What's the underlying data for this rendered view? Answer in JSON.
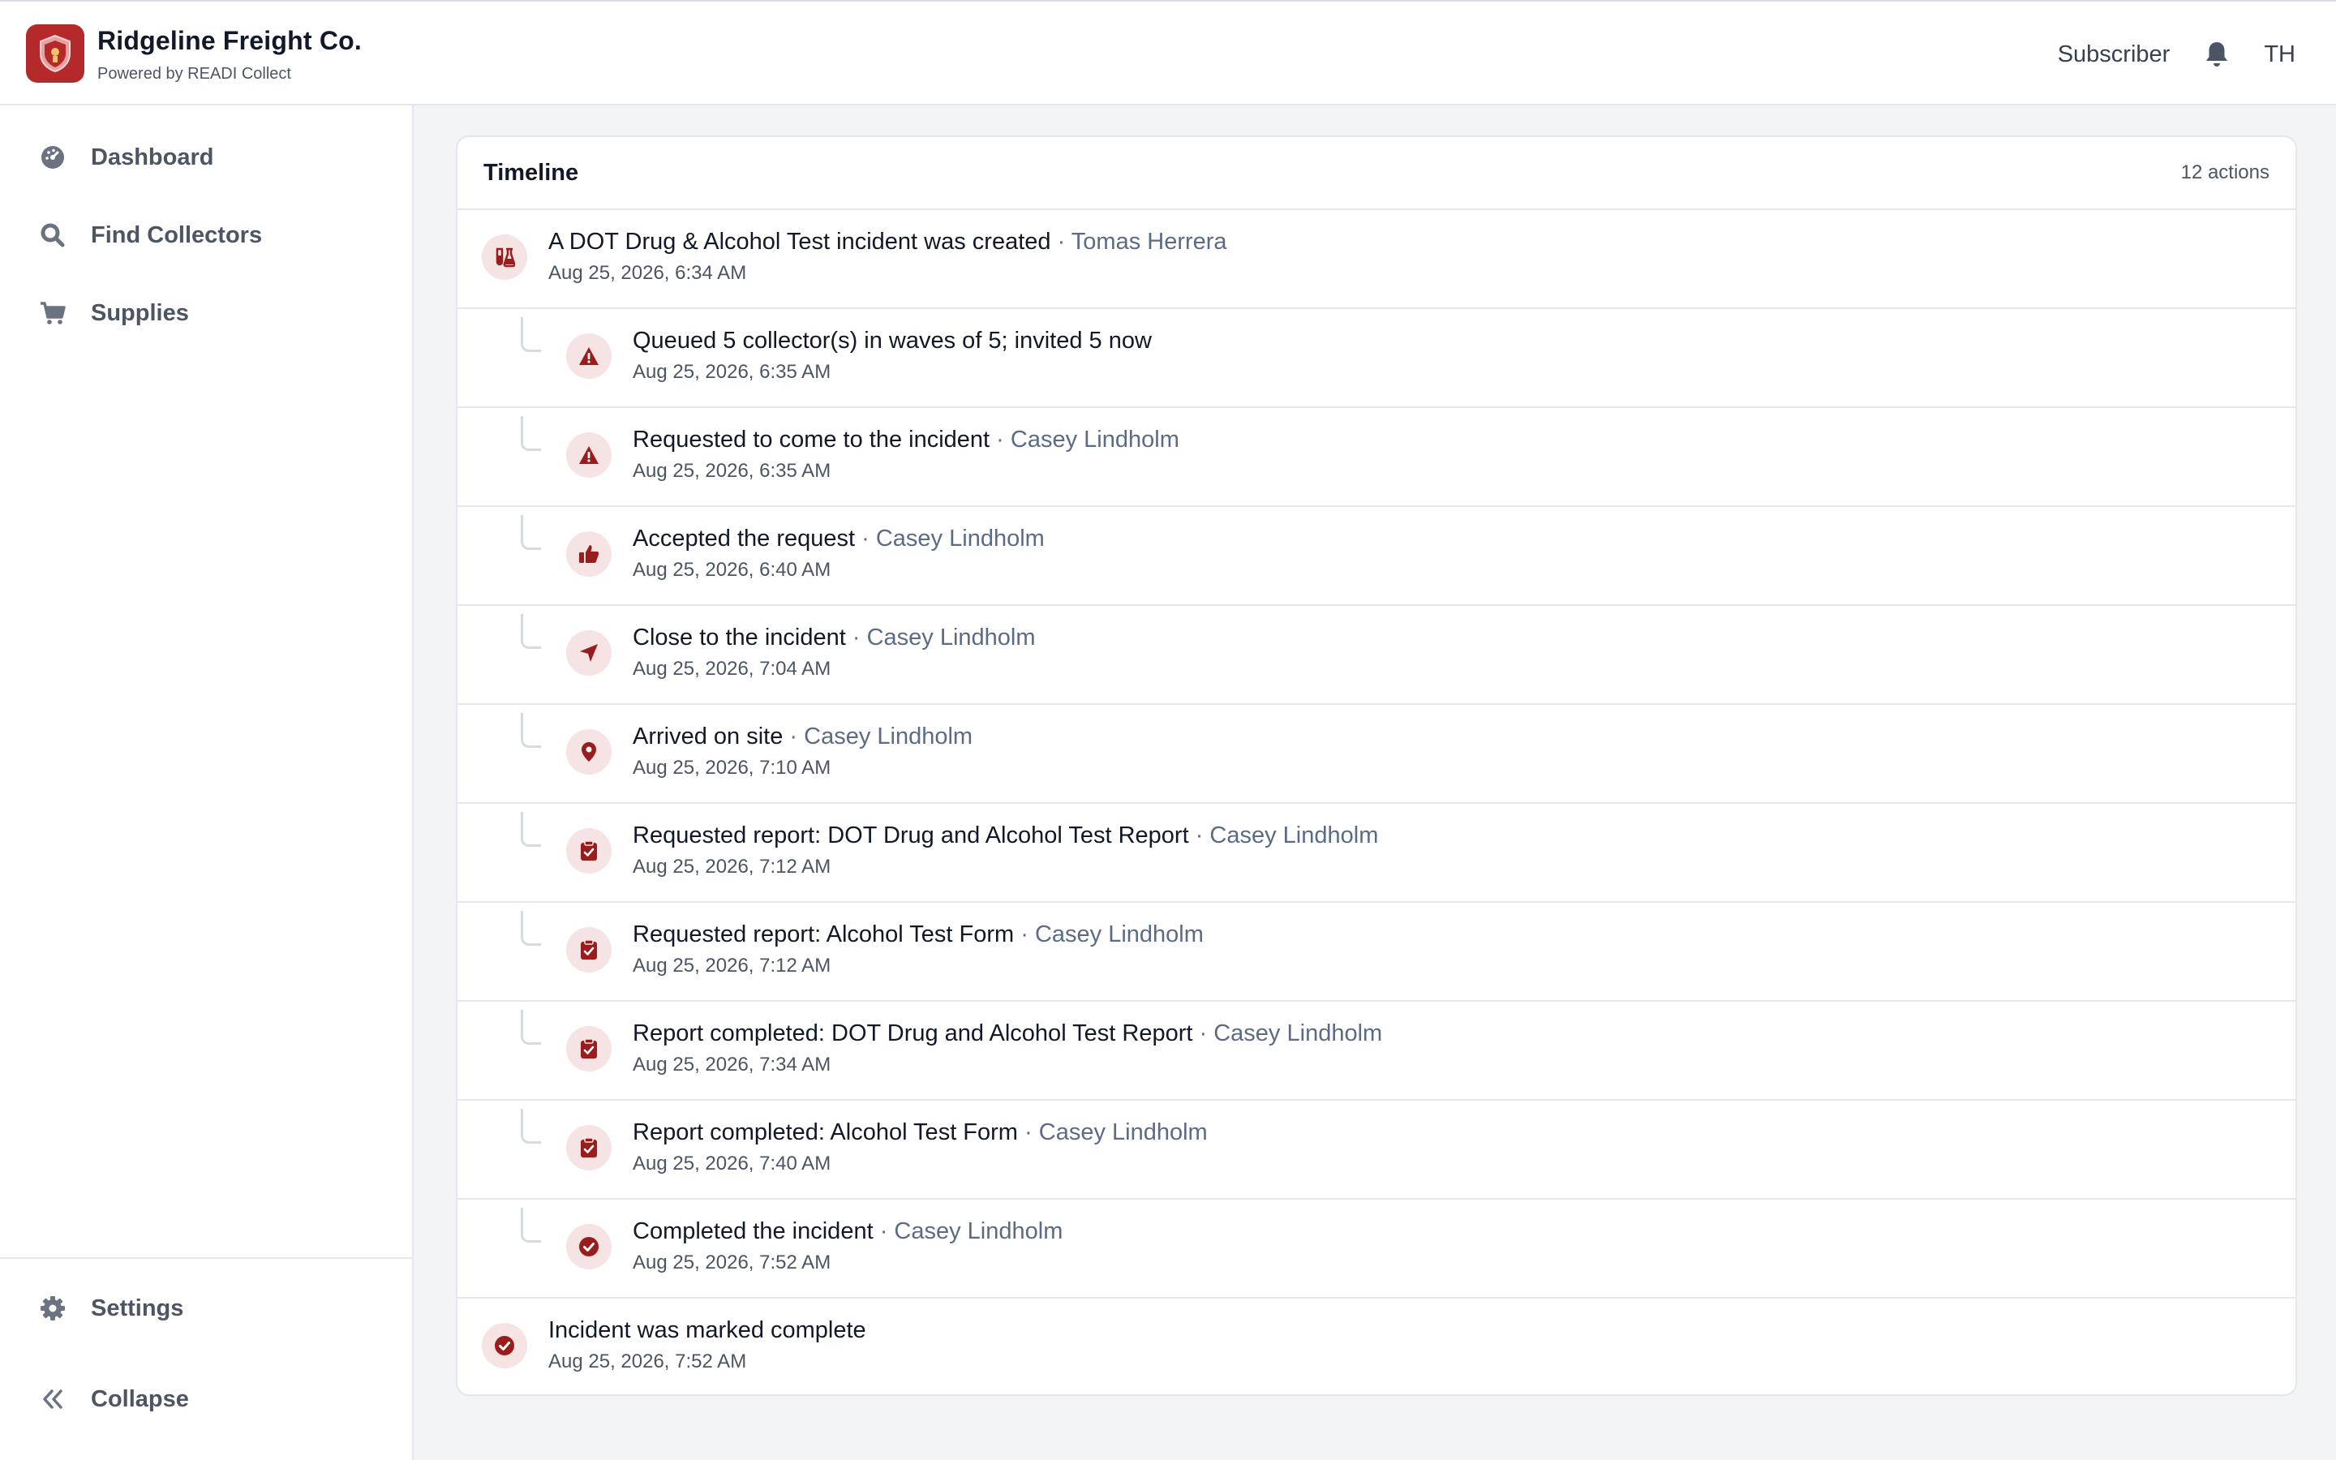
{
  "header": {
    "brand_name": "Ridgeline Freight Co.",
    "brand_sub": "Powered by READI Collect",
    "subscriber_label": "Subscriber",
    "avatar_initials": "TH"
  },
  "sidebar": {
    "items": [
      {
        "label": "Dashboard",
        "icon": "gauge-icon"
      },
      {
        "label": "Find Collectors",
        "icon": "search-icon"
      },
      {
        "label": "Supplies",
        "icon": "cart-icon"
      }
    ],
    "bottom_items": [
      {
        "label": "Settings",
        "icon": "gear-icon"
      },
      {
        "label": "Collapse",
        "icon": "double-chevron-left-icon"
      }
    ]
  },
  "timeline": {
    "title": "Timeline",
    "count": "12 actions",
    "events": [
      {
        "text": "A DOT Drug & Alcohol Test incident was created",
        "actor": "Tomas Herrera",
        "date": "Aug 25, 2026, 6:34 AM",
        "icon": "flask-icon",
        "level": "top"
      },
      {
        "text": "Queued 5 collector(s) in waves of 5; invited 5 now",
        "actor": "",
        "date": "Aug 25, 2026, 6:35 AM",
        "icon": "warning-icon",
        "level": "child"
      },
      {
        "text": "Requested to come to the incident",
        "actor": "Casey Lindholm",
        "date": "Aug 25, 2026, 6:35 AM",
        "icon": "warning-icon",
        "level": "child"
      },
      {
        "text": "Accepted the request",
        "actor": "Casey Lindholm",
        "date": "Aug 25, 2026, 6:40 AM",
        "icon": "thumbs-up-icon",
        "level": "child"
      },
      {
        "text": "Close to the incident",
        "actor": "Casey Lindholm",
        "date": "Aug 25, 2026, 7:04 AM",
        "icon": "navigation-arrow-icon",
        "level": "child"
      },
      {
        "text": "Arrived on site",
        "actor": "Casey Lindholm",
        "date": "Aug 25, 2026, 7:10 AM",
        "icon": "map-pin-icon",
        "level": "child"
      },
      {
        "text": "Requested report: DOT Drug and Alcohol Test Report",
        "actor": "Casey Lindholm",
        "date": "Aug 25, 2026, 7:12 AM",
        "icon": "clipboard-icon",
        "level": "child"
      },
      {
        "text": "Requested report: Alcohol Test Form",
        "actor": "Casey Lindholm",
        "date": "Aug 25, 2026, 7:12 AM",
        "icon": "clipboard-icon",
        "level": "child"
      },
      {
        "text": "Report completed: DOT Drug and Alcohol Test Report",
        "actor": "Casey Lindholm",
        "date": "Aug 25, 2026, 7:34 AM",
        "icon": "clipboard-icon",
        "level": "child"
      },
      {
        "text": "Report completed: Alcohol Test Form",
        "actor": "Casey Lindholm",
        "date": "Aug 25, 2026, 7:40 AM",
        "icon": "clipboard-icon",
        "level": "child"
      },
      {
        "text": "Completed the incident",
        "actor": "Casey Lindholm",
        "date": "Aug 25, 2026, 7:52 AM",
        "icon": "check-circle-icon",
        "level": "child"
      },
      {
        "text": "Incident was marked complete",
        "actor": "",
        "date": "Aug 25, 2026, 7:52 AM",
        "icon": "check-circle-icon",
        "level": "top"
      }
    ]
  },
  "colors": {
    "accent": "#9b1c1c",
    "icon_bg": "#f6e3e3",
    "actor_text": "#5b6b85",
    "page_bg": "#f3f4f7"
  }
}
